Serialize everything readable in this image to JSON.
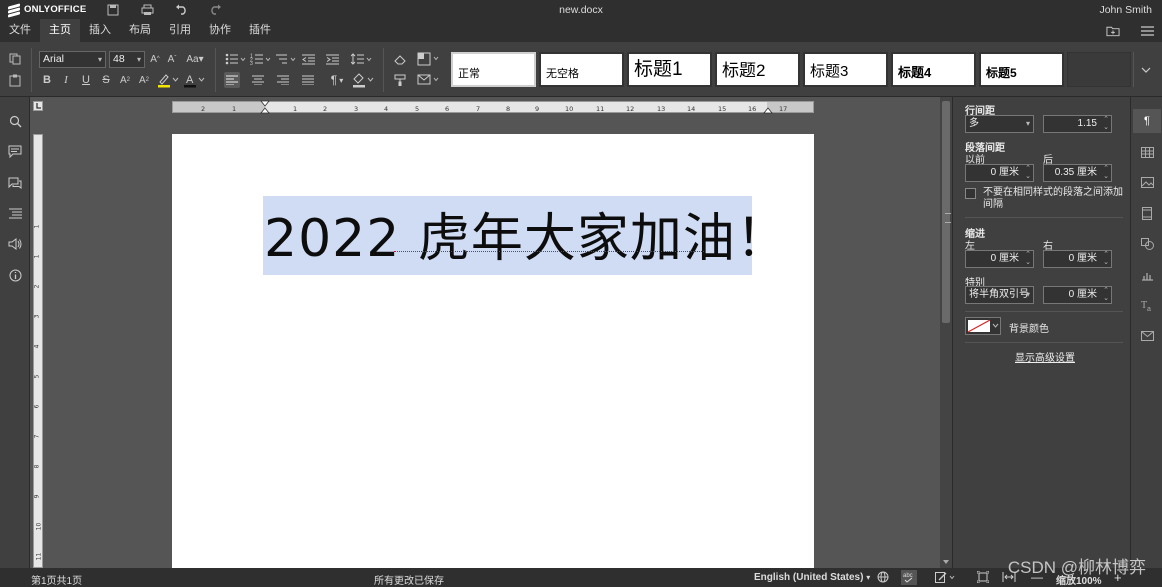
{
  "app": {
    "brand": "ONLYOFFICE",
    "doc_title": "new.docx",
    "user": "John Smith"
  },
  "tabs": [
    "文件",
    "主页",
    "插入",
    "布局",
    "引用",
    "协作",
    "插件"
  ],
  "toolbar": {
    "font_name": "Arial",
    "font_size": "48",
    "styles": [
      "正常",
      "无空格",
      "标题1",
      "标题2",
      "标题3",
      "标题4",
      "标题5"
    ]
  },
  "document": {
    "heading": "2022 虎年大家加油！",
    "ruler_numbers": [
      "2",
      "1",
      "1",
      "2",
      "3",
      "4",
      "5",
      "6",
      "7",
      "8",
      "9",
      "10",
      "11",
      "12",
      "13",
      "14",
      "15",
      "16",
      "17"
    ],
    "vruler_numbers": [
      "1",
      "1",
      "2",
      "3",
      "4",
      "5",
      "6",
      "7",
      "8",
      "9",
      "10",
      "11",
      "12"
    ]
  },
  "panel": {
    "line_spacing_label": "行间距",
    "line_spacing_mode": "多",
    "line_spacing_value": "1.15",
    "para_spacing_label": "段落间距",
    "before_label": "以前",
    "after_label": "后",
    "before_value": "0 厘米",
    "after_value": "0.35 厘米",
    "no_space_same_style": "不要在相同样式的段落之间添加间隔",
    "indent_label": "缩进",
    "left_label": "左",
    "right_label": "右",
    "left_value": "0 厘米",
    "right_value": "0 厘米",
    "special_label": "特别",
    "special_mode": "将半角双引号",
    "special_value": "0 厘米",
    "bg_color_label": "背景颜色",
    "advanced_link": "显示高级设置"
  },
  "status": {
    "page_info": "第1页共1页",
    "saved": "所有更改已保存",
    "language": "English (United States)",
    "zoom": "缩放100%",
    "watermark": "CSDN @柳林博弈"
  },
  "colors": {
    "selection": "#cfdcf3",
    "dark_bg": "#404040",
    "title_bg": "#2f2f2f"
  }
}
